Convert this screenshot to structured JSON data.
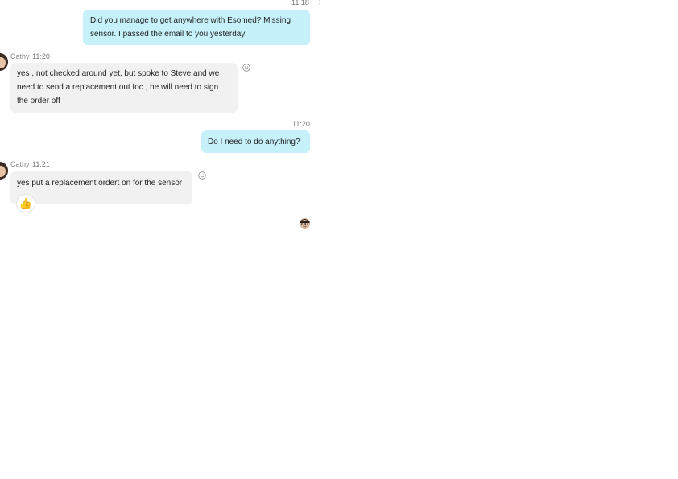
{
  "messages": [
    {
      "direction": "outgoing",
      "time": "11:18",
      "text_lines": [
        "Did you manage to get anywhere with Esomed? Missing",
        "sensor. I passed the email to you yesterday"
      ]
    },
    {
      "direction": "incoming",
      "sender": "Cathy",
      "time": "11:20",
      "text_lines": [
        "yes , not checked around yet, but spoke to Steve and we",
        "need to send a replacement out foc , he will need to sign",
        "the order off"
      ]
    },
    {
      "direction": "outgoing",
      "time": "11:20",
      "text_lines": [
        "Do I need to do anything?"
      ]
    },
    {
      "direction": "incoming",
      "sender": "Cathy",
      "time": "11:21",
      "text_lines": [
        "yes put a replacement ordert on for the sensor"
      ],
      "reaction": "👍"
    }
  ],
  "icons": {
    "contact_avatar": "contact-avatar",
    "add_reaction": "smiley-face-icon",
    "read_receipt_avatar": "read-receipt-avatar",
    "thumbs_up": "thumbs-up-icon",
    "more": "more-options-icon"
  },
  "colors": {
    "outgoing_bubble": "#c7f1fa",
    "incoming_bubble": "#f1f1f1",
    "meta_text": "#8a8a8a"
  }
}
